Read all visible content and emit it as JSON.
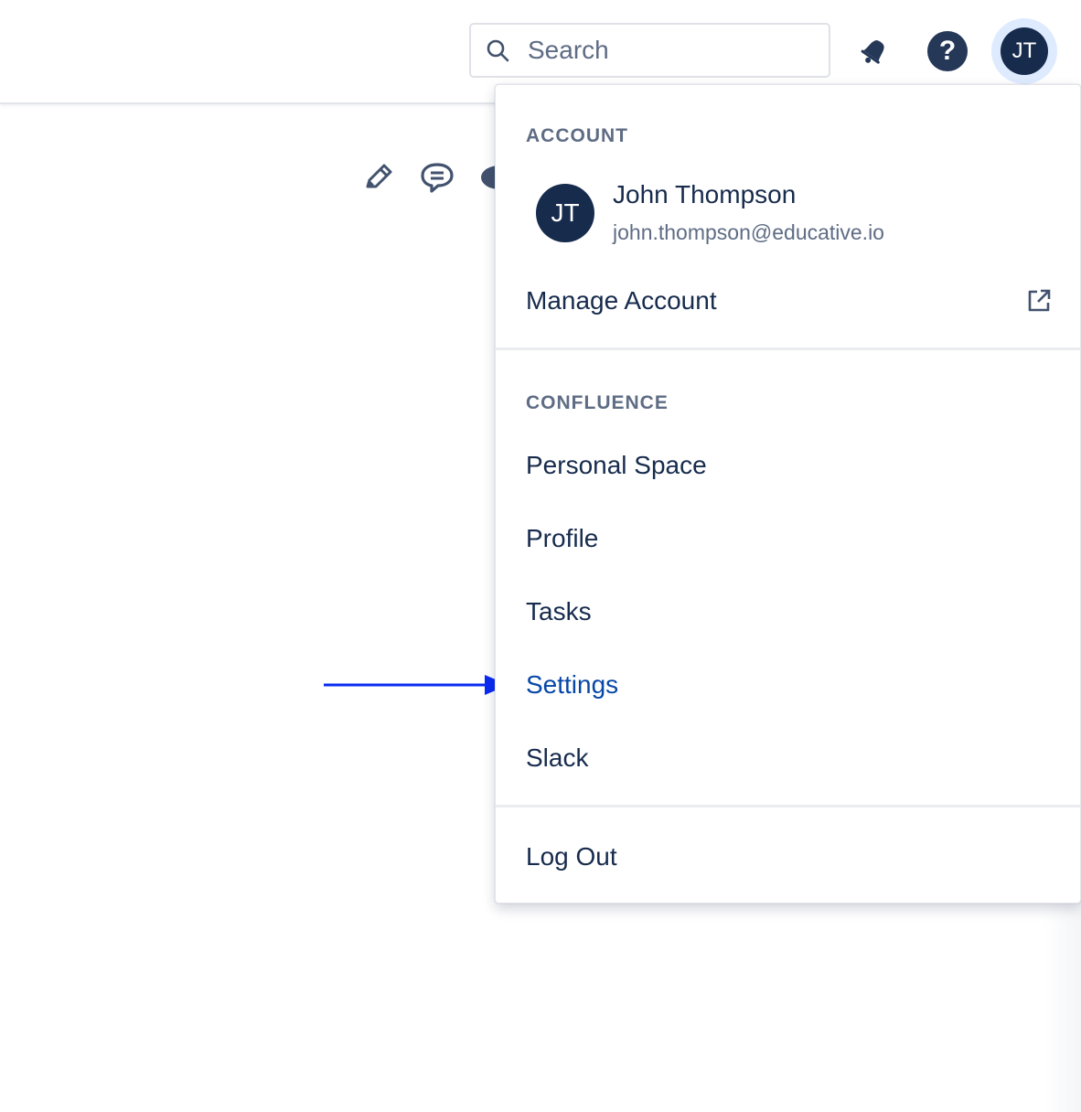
{
  "topbar": {
    "search": {
      "placeholder": "Search"
    },
    "icons": {
      "search": "search-icon",
      "notifications": "bell-icon",
      "help": "help-icon",
      "help_glyph": "?"
    },
    "avatar_initials": "JT"
  },
  "page_actions": {
    "edit": "pencil-icon",
    "comment": "comment-icon",
    "watch": "eye-icon"
  },
  "dropdown": {
    "account_heading": "ACCOUNT",
    "user": {
      "initials": "JT",
      "name": "John Thompson",
      "email": "john.thompson@educative.io"
    },
    "manage_account": "Manage Account",
    "confluence_heading": "CONFLUENCE",
    "items": [
      {
        "label": "Personal Space"
      },
      {
        "label": "Profile"
      },
      {
        "label": "Tasks"
      },
      {
        "label": "Settings"
      },
      {
        "label": "Slack"
      }
    ],
    "log_out": "Log Out"
  },
  "colors": {
    "primary_text": "#172B4D",
    "secondary_text": "#5E6C84",
    "avatar_bg": "#172B4D",
    "active_item": "#0747A6",
    "annotation_arrow": "#0A2BF2"
  }
}
